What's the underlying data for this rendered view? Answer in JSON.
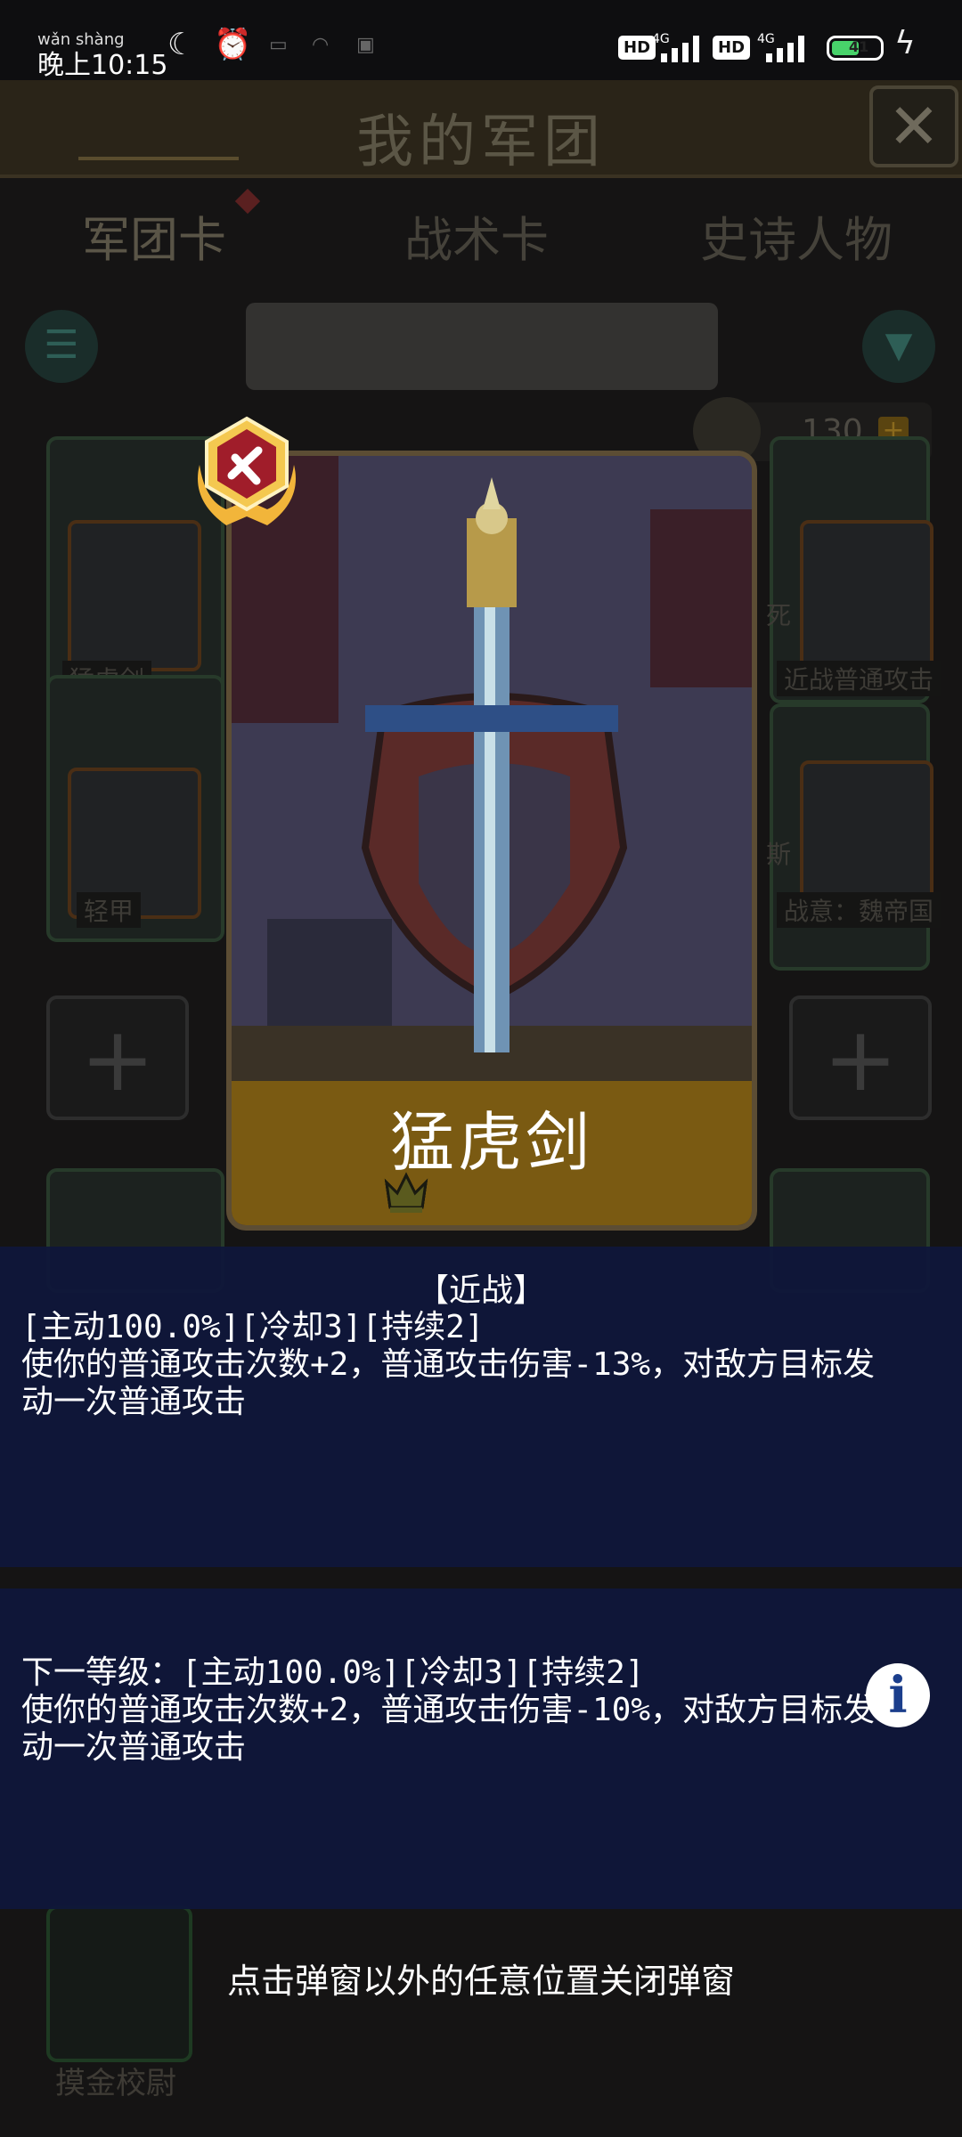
{
  "status_bar": {
    "pinyin": "wǎn shàng",
    "time": "晚上10:15",
    "hd1": "HD",
    "net1": "4G",
    "hd2": "HD",
    "net2": "4G",
    "battery": "41"
  },
  "header": {
    "title": "我的军团",
    "close_icon": "close-icon"
  },
  "tabs": [
    {
      "label": "军团卡",
      "active": true
    },
    {
      "label": "战术卡",
      "active": false
    },
    {
      "label": "史诗人物",
      "active": false
    }
  ],
  "counter": {
    "value": "130"
  },
  "bg_cards": {
    "left1": "猛虎剑",
    "left2": "轻甲",
    "right1_label": "近战普通攻击",
    "right2_label": "战意：魏帝国",
    "right_char1": "死",
    "right_char2": "斯",
    "bottom_label": "摸金校尉"
  },
  "card": {
    "name": "猛虎剑",
    "stars_total": 5,
    "stars_filled": 1,
    "badge_icon": "sword-shield-badge-icon"
  },
  "popup": {
    "category": "【近战】",
    "current_text": "[主动100.0%][冷却3][持续2]\n使你的普通攻击次数+2，普通攻击伤害-13%，对敌方目标发\n动一次普通攻击",
    "next_text": "下一等级：[主动100.0%][冷却3][持续2]\n使你的普通攻击次数+2，普通攻击伤害-10%，对敌方目标发\n动一次普通攻击",
    "info_label": "i",
    "hint": "点击弹窗以外的任意位置关闭弹窗"
  },
  "colors": {
    "panel": "#0f163a",
    "banner": "#7a5a12",
    "crown_filled": "#f2e24a",
    "crown_empty": "#5a5a1e"
  }
}
